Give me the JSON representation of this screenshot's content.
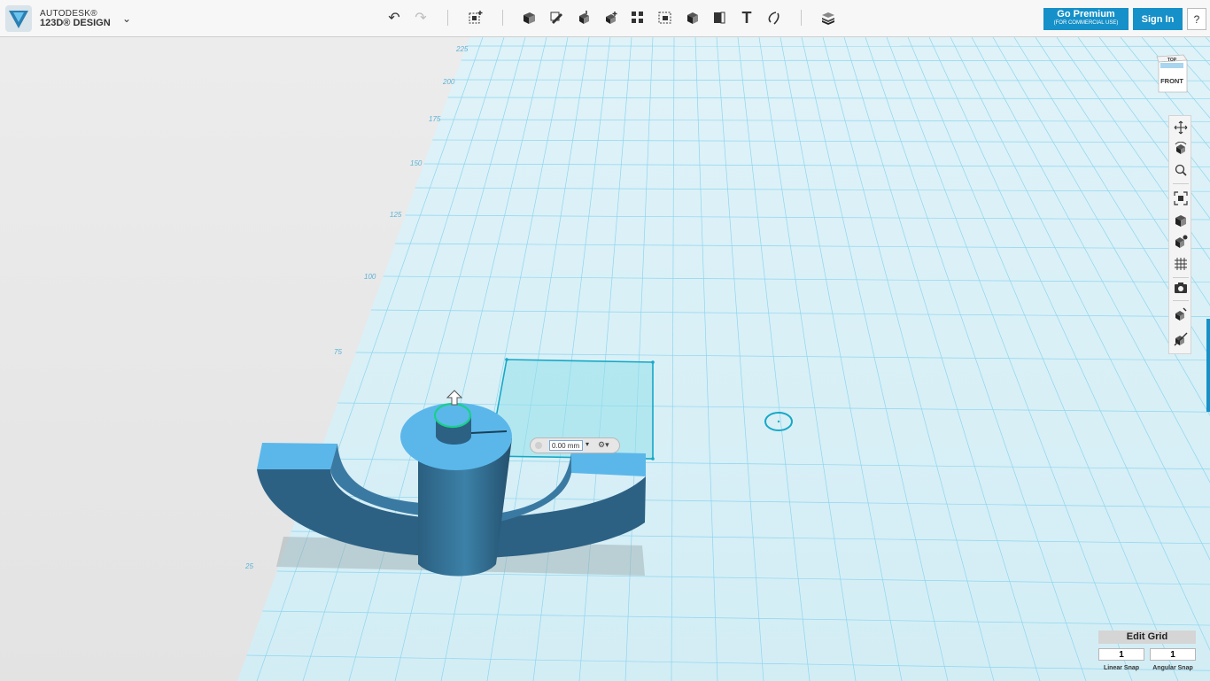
{
  "app": {
    "brand_line1": "AUTODESK®",
    "brand_line2": "123D® DESIGN",
    "menu_chevron": "⌄"
  },
  "toolbar": {
    "undo": "↶",
    "redo": "↷",
    "tools": [
      "transform-icon",
      "primitives-icon",
      "sketch-icon",
      "construct-icon",
      "modify-icon",
      "pattern-icon",
      "grouping-icon",
      "combine-icon",
      "measure-icon",
      "text-icon",
      "snap-icon",
      "materials-icon"
    ],
    "text_tool_label": "T"
  },
  "account": {
    "premium_label": "Go Premium",
    "premium_sub": "(FOR COMMERCIAL USE)",
    "signin_label": "Sign In",
    "help_label": "?"
  },
  "viewcube": {
    "top_label": "TOP",
    "front_label": "FRONT"
  },
  "nav_tools": [
    "pan-icon",
    "orbit-icon",
    "zoom-icon",
    "fit-icon",
    "view-icon",
    "visibility-icon",
    "grid-view-icon",
    "screenshot-icon",
    "materials-view-icon",
    "hide-icon"
  ],
  "grid_labels": [
    "225",
    "200",
    "175",
    "150",
    "125",
    "100",
    "75",
    "25"
  ],
  "measure": {
    "value": "0.00 mm"
  },
  "grid_panel": {
    "edit_label": "Edit Grid",
    "linear_value": "1",
    "angular_value": "1",
    "linear_label": "Linear Snap",
    "angular_label": "Angular Snap"
  },
  "colors": {
    "accent": "#1590c8",
    "model_top": "#5db8ea",
    "model_side": "#2d6a8e",
    "grid": "#7fd1ec"
  }
}
